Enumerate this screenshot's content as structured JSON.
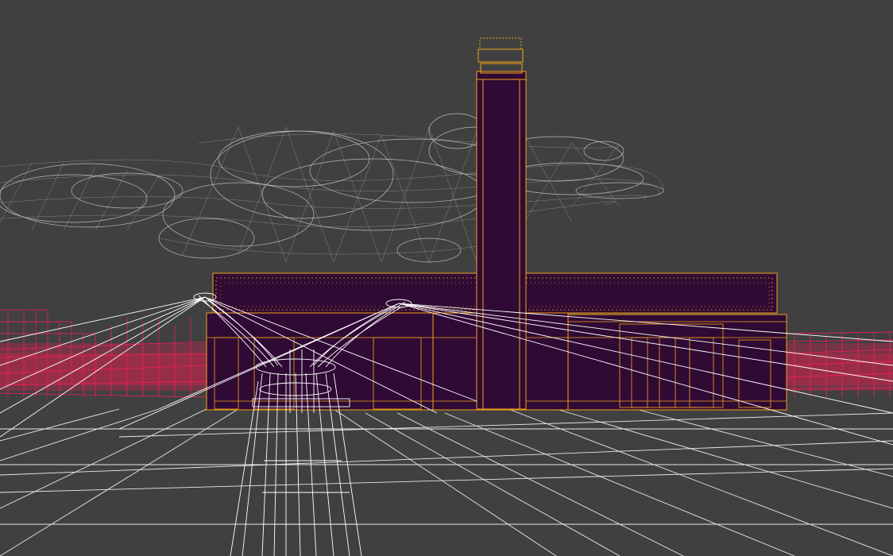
{
  "scene": {
    "subject": "wireframe-render-power-station-with-chimney",
    "colors": {
      "background": "#404040",
      "cloud": "#c8c8c8",
      "building_fill": "#2f0a34",
      "building_edge": "#f5a31a",
      "street_lines": "#ff1a55",
      "canopy_lines": "#ffffff",
      "ground_lines": "#ffffff"
    }
  }
}
